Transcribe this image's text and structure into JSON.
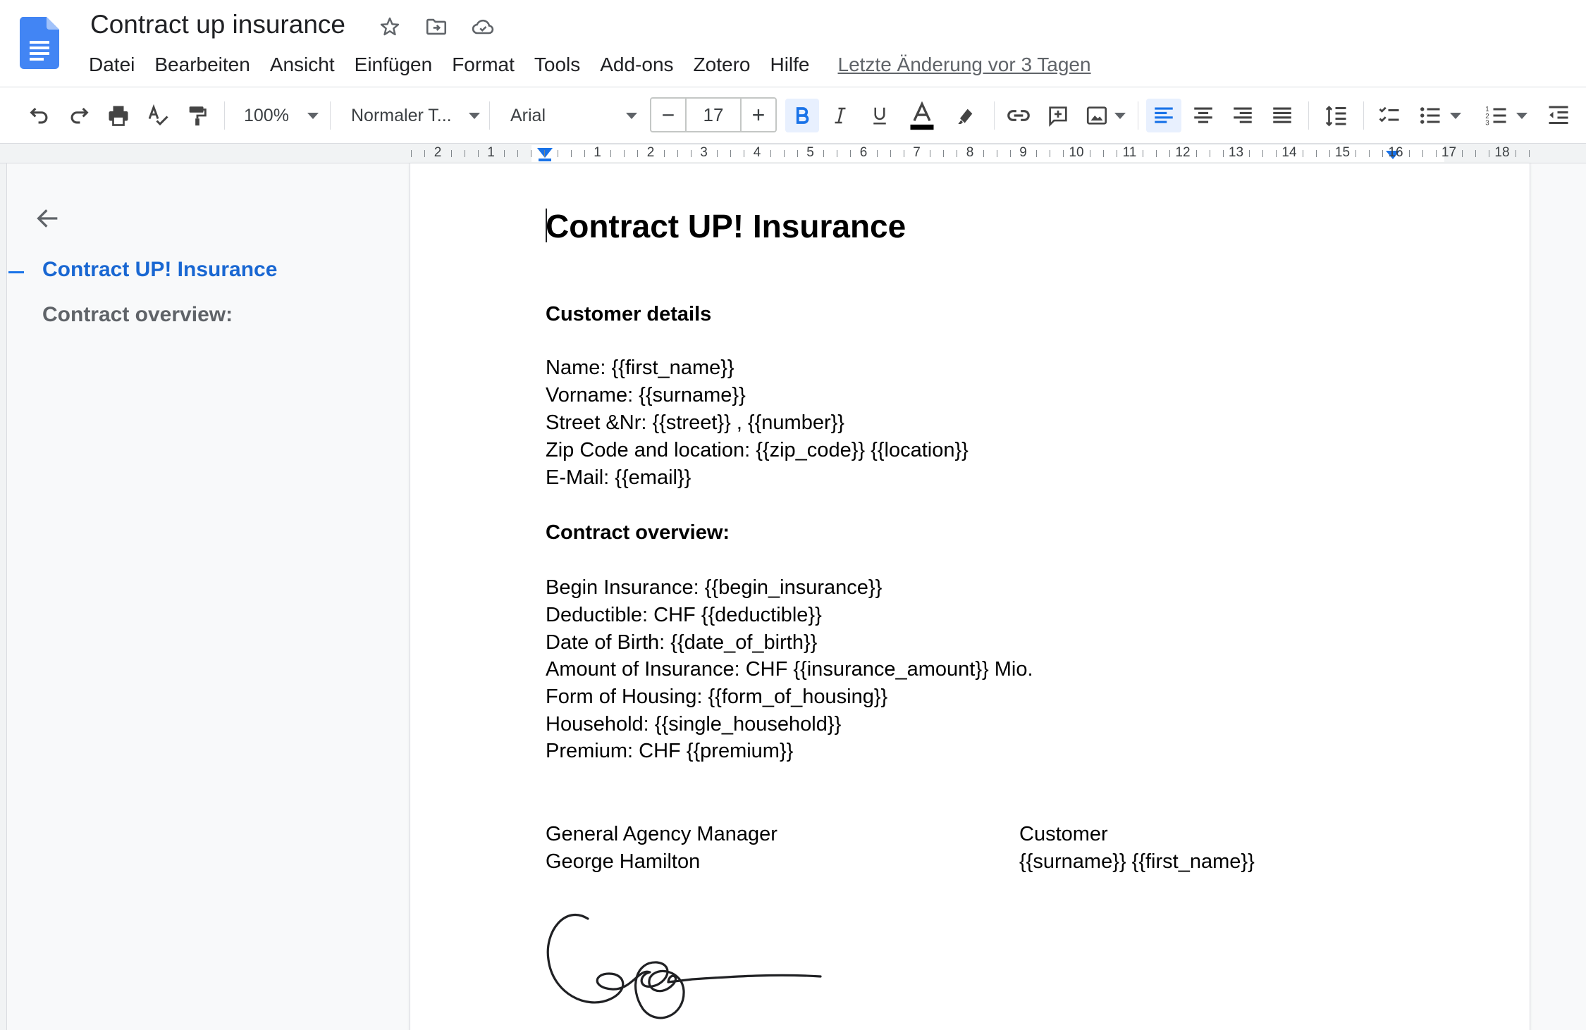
{
  "app": {
    "doc_title": "Contract up insurance",
    "last_edit": "Letzte Änderung vor 3 Tagen",
    "menu": [
      "Datei",
      "Bearbeiten",
      "Ansicht",
      "Einfügen",
      "Format",
      "Tools",
      "Add-ons",
      "Zotero",
      "Hilfe"
    ]
  },
  "toolbar": {
    "zoom": "100%",
    "style": "Normaler T...",
    "font": "Arial",
    "font_size": "17",
    "minus": "−",
    "plus": "+",
    "bold_active": true,
    "align": "left"
  },
  "ruler": {
    "numbers": [
      "2",
      "1",
      "1",
      "2",
      "3",
      "4",
      "5",
      "6",
      "7",
      "8",
      "9",
      "10",
      "11",
      "12",
      "13",
      "14",
      "15",
      "16",
      "17",
      "18"
    ]
  },
  "outline": {
    "items": [
      "Contract UP! Insurance",
      "Contract overview:"
    ]
  },
  "document": {
    "title": "Contract UP! Insurance",
    "customer_heading": "Customer details",
    "customer_lines": [
      "Name: {{first_name}}",
      "Vorname: {{surname}}",
      "Street &Nr: {{street}} , {{number}}",
      "Zip Code and location: {{zip_code}} {{location}}",
      "E-Mail: {{email}}"
    ],
    "contract_heading": "Contract overview:",
    "contract_lines": [
      "Begin Insurance: {{begin_insurance}}",
      "Deductible: CHF {{deductible}}",
      "Date of Birth: {{date_of_birth}}",
      "Amount of Insurance: CHF {{insurance_amount}} Mio.",
      "Form of Housing: {{form_of_housing}}",
      "Household: {{single_household}}",
      "Premium: CHF {{premium}}"
    ],
    "sign_left": [
      "General Agency Manager",
      "George Hamilton"
    ],
    "sign_right": [
      "Customer",
      "{{surname}} {{first_name}}"
    ]
  },
  "colors": {
    "accent": "#1a73e8",
    "outline_active": "#1967d2",
    "doc_icon": "#4285f4"
  }
}
